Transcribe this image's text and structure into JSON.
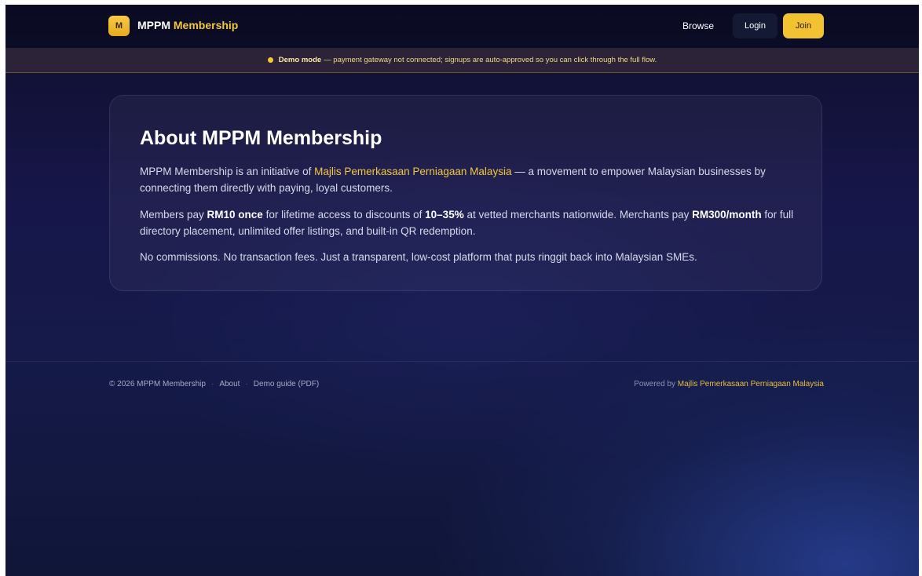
{
  "header": {
    "logo_letter": "M",
    "brand_main": "MPPM",
    "brand_accent": "Membership",
    "nav_browse": "Browse",
    "login_label": "Login",
    "join_label": "Join"
  },
  "banner": {
    "bold": "Demo mode",
    "text": "— payment gateway not connected; signups are auto-approved so you can click through the full flow."
  },
  "about": {
    "title": "About MPPM Membership",
    "p1_pre": "MPPM Membership is an initiative of ",
    "p1_link": "Majlis Pemerkasaan Perniagaan Malaysia",
    "p1_post": " — a movement to empower Malaysian businesses by connecting them directly with paying, loyal customers.",
    "p2_a": "Members pay ",
    "p2_b": "RM10 once",
    "p2_c": " for lifetime access to discounts of ",
    "p2_d": "10–35%",
    "p2_e": " at vetted merchants nationwide. Merchants pay ",
    "p2_f": "RM300/month",
    "p2_g": " for full directory placement, unlimited offer listings, and built-in QR redemption.",
    "p3": "No commissions. No transaction fees. Just a transparent, low-cost platform that puts ringgit back into Malaysian SMEs."
  },
  "footer": {
    "copyright": "© 2026 MPPM Membership",
    "sep": "·",
    "about_link": "About",
    "demo_guide_link": "Demo guide (PDF)",
    "powered_by": "Powered by ",
    "powered_link": "Majlis Pemerkasaan Perniagaan Malaysia"
  },
  "colors": {
    "accent": "#f2c640",
    "background": "#151a4a",
    "banner_bg": "#2c2338"
  }
}
